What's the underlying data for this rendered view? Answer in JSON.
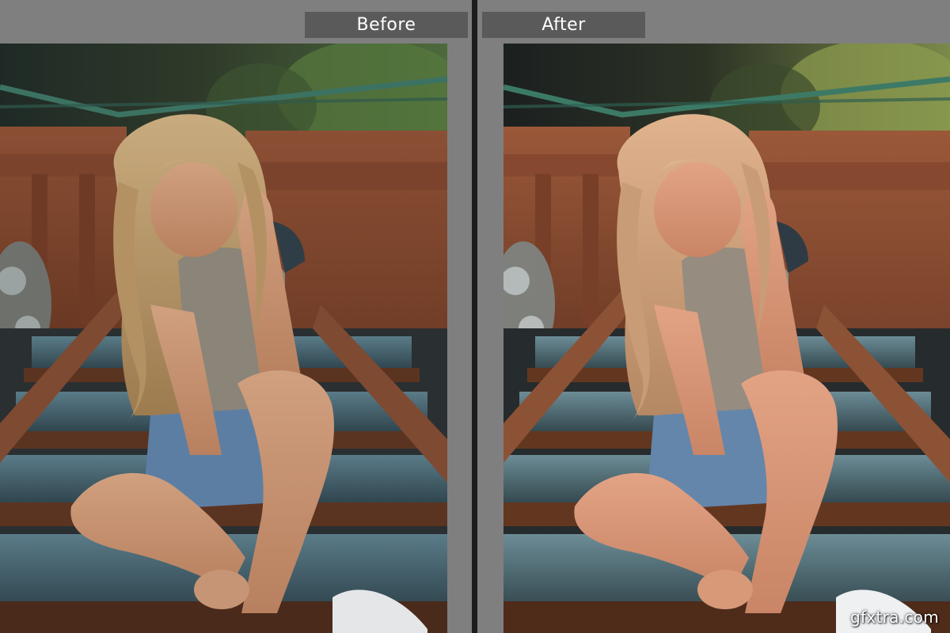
{
  "comparison": {
    "before_label": "Before",
    "after_label": "After"
  },
  "watermark": {
    "text": "gfxtra.com"
  },
  "colors": {
    "ui_gray": "#7f7f7f",
    "label_bg": "#5a5a5a",
    "divider": "#1d1d1d",
    "label_text": "#ffffff"
  },
  "photo": {
    "subject": "woman with long blonde hair sitting on metal bridge steps",
    "before_grade": "original",
    "after_grade": "warm-toned edit"
  }
}
